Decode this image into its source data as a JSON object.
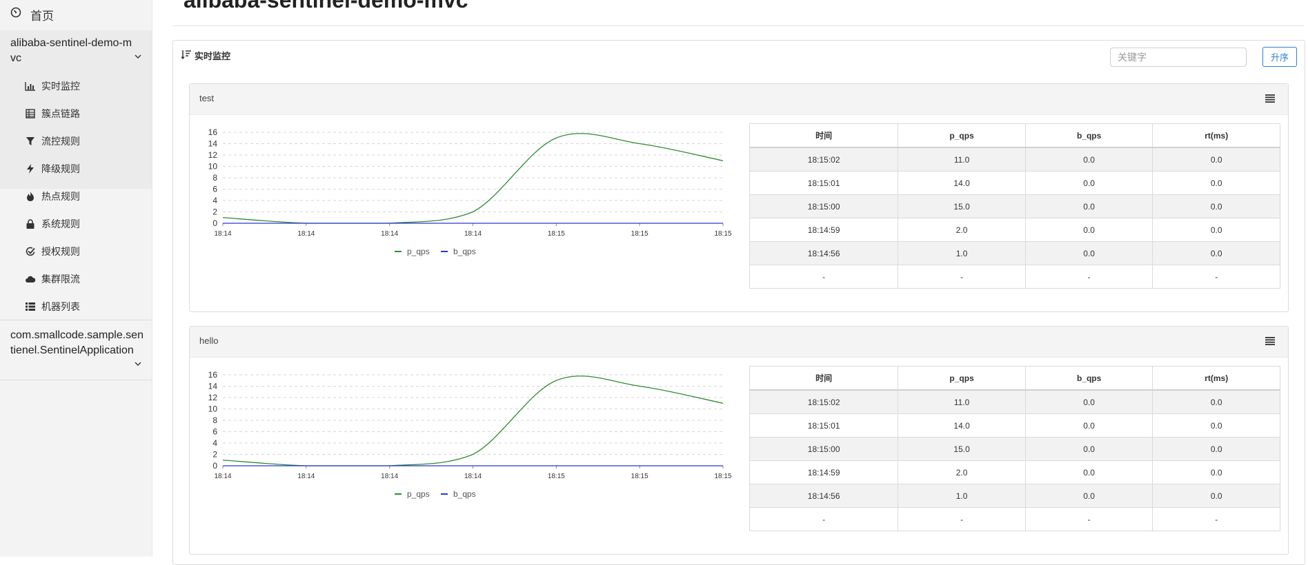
{
  "sidebar": {
    "home_label": "首页",
    "apps": [
      {
        "name": "alibaba-sentinel-demo-mvc",
        "items": [
          {
            "label": "实时监控",
            "icon": "bar-chart-icon"
          },
          {
            "label": "簇点链路",
            "icon": "list-table-icon"
          },
          {
            "label": "流控规则",
            "icon": "filter-icon"
          },
          {
            "label": "降级规则",
            "icon": "lightning-icon"
          },
          {
            "label": "热点规则",
            "icon": "flame-icon"
          },
          {
            "label": "系统规则",
            "icon": "lock-icon"
          },
          {
            "label": "授权规则",
            "icon": "check-circle-icon"
          },
          {
            "label": "集群限流",
            "icon": "cloud-icon"
          },
          {
            "label": "机器列表",
            "icon": "list-icon"
          }
        ]
      },
      {
        "name": "com.smallcode.sample.sentienel.SentinelApplication",
        "items": []
      }
    ]
  },
  "page": {
    "title": "alibaba-sentinel-demo-mvc"
  },
  "panel": {
    "title": "实时监控",
    "search_placeholder": "关键字",
    "sort_label": "升序"
  },
  "colors": {
    "p_qps": "#2e8b2e",
    "b_qps": "#2a35d6",
    "accent": "#2f7fcf"
  },
  "table_headers": [
    "时间",
    "p_qps",
    "b_qps",
    "rt(ms)"
  ],
  "resources": [
    {
      "name": "test",
      "rows": [
        [
          "18:15:02",
          "11.0",
          "0.0",
          "0.0"
        ],
        [
          "18:15:01",
          "14.0",
          "0.0",
          "0.0"
        ],
        [
          "18:15:00",
          "15.0",
          "0.0",
          "0.0"
        ],
        [
          "18:14:59",
          "2.0",
          "0.0",
          "0.0"
        ],
        [
          "18:14:56",
          "1.0",
          "0.0",
          "0.0"
        ],
        [
          "-",
          "-",
          "-",
          "-"
        ]
      ]
    },
    {
      "name": "hello",
      "rows": [
        [
          "18:15:02",
          "11.0",
          "0.0",
          "0.0"
        ],
        [
          "18:15:01",
          "14.0",
          "0.0",
          "0.0"
        ],
        [
          "18:15:00",
          "15.0",
          "0.0",
          "0.0"
        ],
        [
          "18:14:59",
          "2.0",
          "0.0",
          "0.0"
        ],
        [
          "18:14:56",
          "1.0",
          "0.0",
          "0.0"
        ],
        [
          "-",
          "-",
          "-",
          "-"
        ]
      ]
    }
  ],
  "chart_data": [
    {
      "type": "line",
      "x": [
        "18:14",
        "18:14",
        "18:14",
        "18:14",
        "18:15",
        "18:15",
        "18:15"
      ],
      "ylim": [
        0,
        16
      ],
      "yticks": [
        0,
        2,
        4,
        6,
        8,
        10,
        12,
        14,
        16
      ],
      "grid": true,
      "legend_position": "bottom",
      "series": [
        {
          "name": "p_qps",
          "values": [
            1,
            0,
            0,
            2,
            15,
            14,
            11
          ]
        },
        {
          "name": "b_qps",
          "values": [
            0,
            0,
            0,
            0,
            0,
            0,
            0
          ]
        }
      ]
    },
    {
      "type": "line",
      "x": [
        "18:14",
        "18:14",
        "18:14",
        "18:14",
        "18:15",
        "18:15",
        "18:15"
      ],
      "ylim": [
        0,
        16
      ],
      "yticks": [
        0,
        2,
        4,
        6,
        8,
        10,
        12,
        14,
        16
      ],
      "grid": true,
      "legend_position": "bottom",
      "series": [
        {
          "name": "p_qps",
          "values": [
            1,
            0,
            0,
            2,
            15,
            14,
            11
          ]
        },
        {
          "name": "b_qps",
          "values": [
            0,
            0,
            0,
            0,
            0,
            0,
            0
          ]
        }
      ]
    }
  ]
}
